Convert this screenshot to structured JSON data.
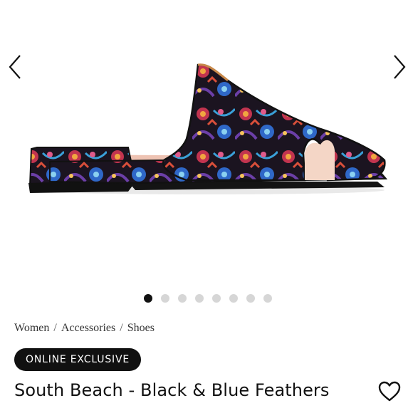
{
  "carousel": {
    "prev_icon": "chevron-left-icon",
    "next_icon": "chevron-right-icon",
    "image_alt": "",
    "slide_count": 8,
    "active_slide": 1
  },
  "breadcrumb": {
    "items": [
      "Women",
      "Accessories",
      "Shoes"
    ],
    "separator": "/"
  },
  "badge": {
    "label": "ONLINE EXCLUSIVE"
  },
  "product": {
    "title": "South Beach - Black & Blue Feathers"
  },
  "wishlist": {
    "icon": "heart-icon"
  },
  "colors": {
    "text": "#111111",
    "badge_bg": "#111111",
    "badge_text": "#ffffff",
    "dot_inactive": "#d6d6d6",
    "dot_active": "#111111"
  }
}
